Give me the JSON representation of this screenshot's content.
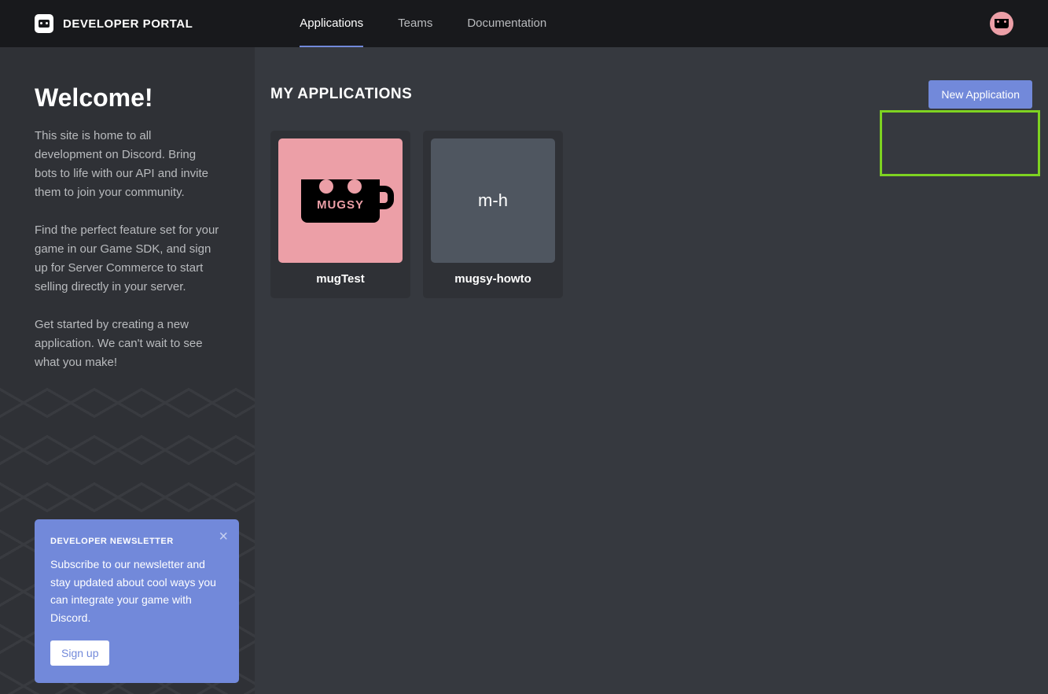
{
  "header": {
    "siteTitle": "DEVELOPER PORTAL",
    "nav": [
      {
        "label": "Applications",
        "active": true
      },
      {
        "label": "Teams",
        "active": false
      },
      {
        "label": "Documentation",
        "active": false
      }
    ]
  },
  "sidebar": {
    "welcomeTitle": "Welcome!",
    "paragraphs": [
      "This site is home to all development on Discord. Bring bots to life with our API and invite them to join your community.",
      "Find the perfect feature set for your game in our Game SDK, and sign up for Server Commerce to start selling directly in your server.",
      "Get started by creating a new application. We can't wait to see what you make!"
    ],
    "newsletter": {
      "title": "DEVELOPER NEWSLETTER",
      "text": "Subscribe to our newsletter and stay updated about cool ways you can integrate your game with Discord.",
      "signupLabel": "Sign up"
    }
  },
  "main": {
    "title": "MY APPLICATIONS",
    "newAppLabel": "New Application",
    "apps": [
      {
        "name": "mugTest",
        "thumbType": "mugsy",
        "mugText": "MUGSY"
      },
      {
        "name": "mugsy-howto",
        "thumbType": "initials",
        "initials": "m-h"
      }
    ]
  },
  "colors": {
    "accent": "#7289da",
    "highlight": "#7ed321",
    "pink": "#ec9fa7"
  }
}
